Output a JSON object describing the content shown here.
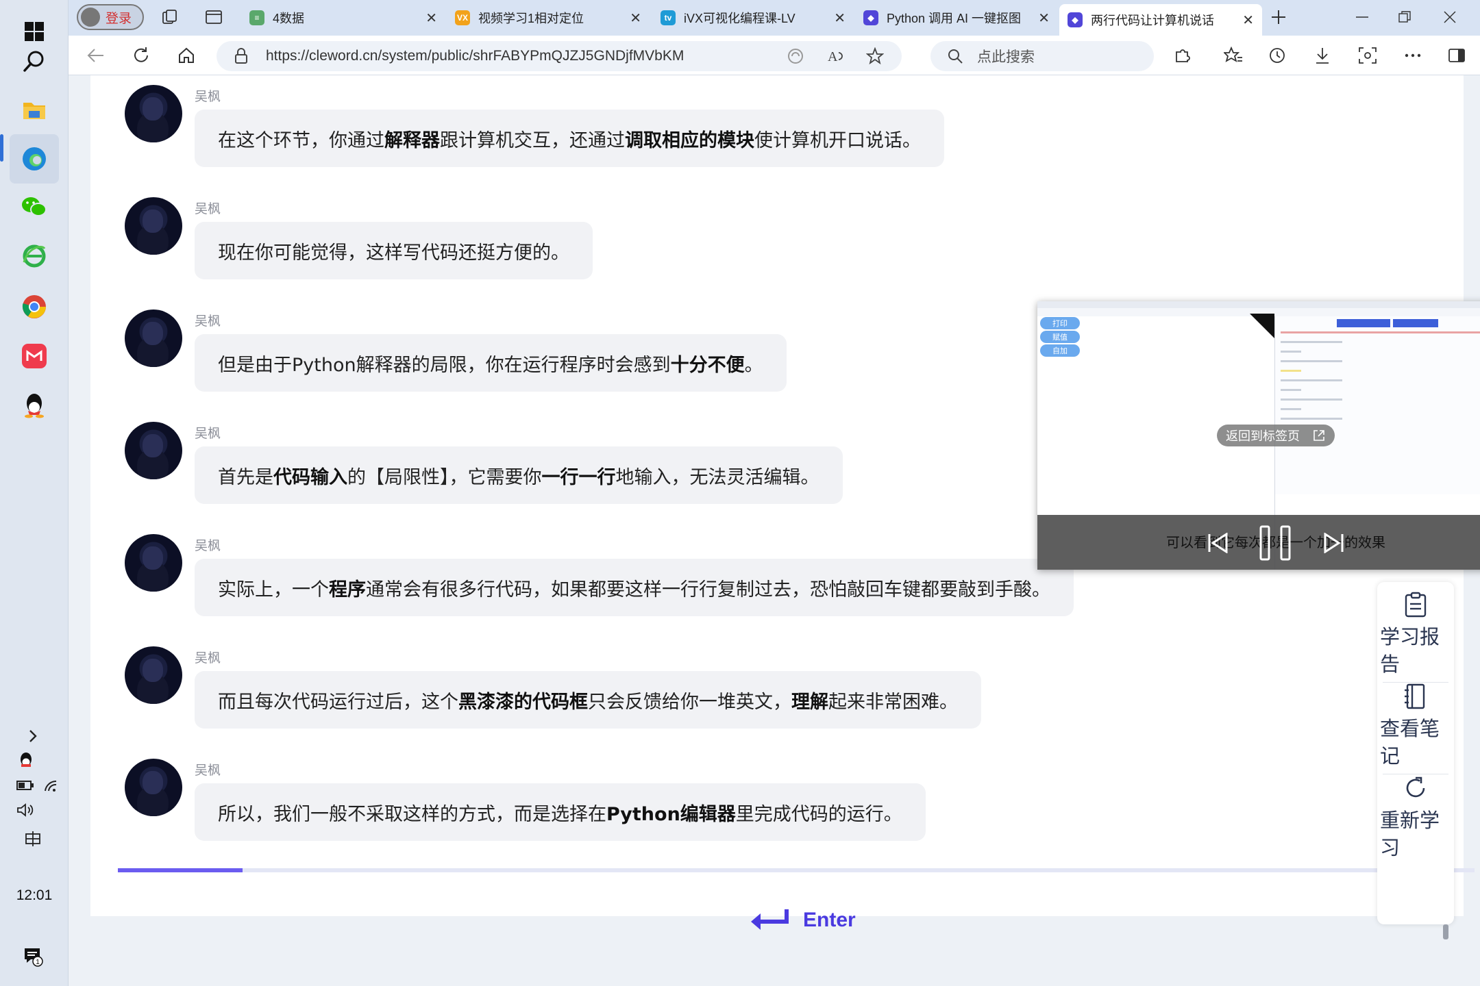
{
  "taskbar": {
    "clock": "12:01",
    "apps": [
      "start",
      "search",
      "file-explorer",
      "edge",
      "wechat",
      "ie",
      "chrome",
      "app-red",
      "qq"
    ]
  },
  "browser": {
    "login_label": "登录",
    "tabs": [
      {
        "title": "4数据",
        "favicon": "#5aa86b"
      },
      {
        "title": "视频学习1相对定位",
        "favicon": "#f2a21b"
      },
      {
        "title": "iVX可视化编程课-LV",
        "favicon": "#1f9bd6"
      },
      {
        "title": "Python 调用 AI 一键抠图",
        "favicon": "#5146d8"
      },
      {
        "title": "两行代码让计算机说话",
        "favicon": "#5146d8"
      }
    ],
    "url": "https://cleword.cn/system/public/shrFABYPmQJZJ5GNDjfMVbKM",
    "search_placeholder": "点此搜索"
  },
  "chat": {
    "sender": "吴枫",
    "messages": [
      {
        "parts": [
          {
            "t": "在这个环节，你通过"
          },
          {
            "t": "解释器",
            "b": true
          },
          {
            "t": "跟计算机交互，还通过"
          },
          {
            "t": "调取相应的模块",
            "b": true
          },
          {
            "t": "使计算机开口说话。"
          }
        ]
      },
      {
        "parts": [
          {
            "t": "现在你可能觉得，这样写代码还挺方便的。"
          }
        ]
      },
      {
        "parts": [
          {
            "t": "但是由于Python解释器的局限，你在运行程序时会感到"
          },
          {
            "t": "十分不便",
            "b": true
          },
          {
            "t": "。"
          }
        ]
      },
      {
        "parts": [
          {
            "t": "首先是"
          },
          {
            "t": "代码输入",
            "b": true
          },
          {
            "t": "的【局限性】，它需要你"
          },
          {
            "t": "一行一行",
            "b": true
          },
          {
            "t": "地输入，无法灵活编辑。"
          }
        ]
      },
      {
        "parts": [
          {
            "t": "实际上，一个"
          },
          {
            "t": "程序",
            "b": true
          },
          {
            "t": "通常会有很多行代码，如果都要这样一行行复制过去，恐怕敲回车键都要敲到手酸。"
          }
        ]
      },
      {
        "parts": [
          {
            "t": "而且每次代码运行过后，这个"
          },
          {
            "t": "黑漆漆的代码框",
            "b": true
          },
          {
            "t": "只会反馈给你一堆英文，"
          },
          {
            "t": "理解",
            "b": true
          },
          {
            "t": "起来非常困难。"
          }
        ]
      },
      {
        "parts": [
          {
            "t": "所以，我们一般不采取这样的方式，而是选择在"
          },
          {
            "t": "Python编辑器",
            "b": true
          },
          {
            "t": "里完成代码的运行。"
          }
        ]
      }
    ]
  },
  "progress": {
    "fraction": 0.092
  },
  "enter_label": "Enter",
  "side_panel": {
    "items": [
      {
        "label": "学习报告",
        "icon": "clipboard-icon"
      },
      {
        "label": "查看笔记",
        "icon": "notebook-icon"
      },
      {
        "label": "重新学习",
        "icon": "refresh-icon"
      }
    ]
  },
  "pip": {
    "buttons": [
      "打印",
      "赋值",
      "自加"
    ],
    "back_label": "返回到标签页",
    "caption": "可以看到它每次都是一个加一的效果"
  },
  "colors": {
    "accent": "#4a3ae0",
    "progress": "#6b5cf0",
    "bubble": "#f1f2f5"
  }
}
